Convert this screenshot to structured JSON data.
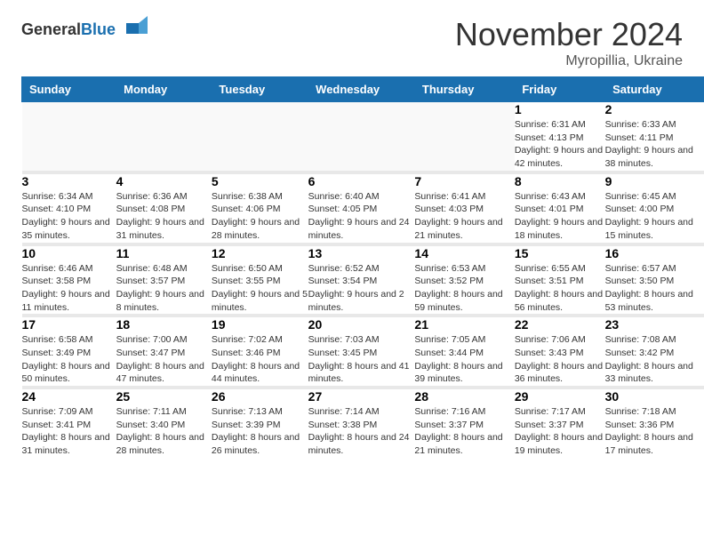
{
  "logo": {
    "general": "General",
    "blue": "Blue"
  },
  "title": "November 2024",
  "location": "Myropillia, Ukraine",
  "weekdays": [
    "Sunday",
    "Monday",
    "Tuesday",
    "Wednesday",
    "Thursday",
    "Friday",
    "Saturday"
  ],
  "weeks": [
    [
      {
        "day": "",
        "sunrise": "",
        "sunset": "",
        "daylight": ""
      },
      {
        "day": "",
        "sunrise": "",
        "sunset": "",
        "daylight": ""
      },
      {
        "day": "",
        "sunrise": "",
        "sunset": "",
        "daylight": ""
      },
      {
        "day": "",
        "sunrise": "",
        "sunset": "",
        "daylight": ""
      },
      {
        "day": "",
        "sunrise": "",
        "sunset": "",
        "daylight": ""
      },
      {
        "day": "1",
        "sunrise": "Sunrise: 6:31 AM",
        "sunset": "Sunset: 4:13 PM",
        "daylight": "Daylight: 9 hours and 42 minutes."
      },
      {
        "day": "2",
        "sunrise": "Sunrise: 6:33 AM",
        "sunset": "Sunset: 4:11 PM",
        "daylight": "Daylight: 9 hours and 38 minutes."
      }
    ],
    [
      {
        "day": "3",
        "sunrise": "Sunrise: 6:34 AM",
        "sunset": "Sunset: 4:10 PM",
        "daylight": "Daylight: 9 hours and 35 minutes."
      },
      {
        "day": "4",
        "sunrise": "Sunrise: 6:36 AM",
        "sunset": "Sunset: 4:08 PM",
        "daylight": "Daylight: 9 hours and 31 minutes."
      },
      {
        "day": "5",
        "sunrise": "Sunrise: 6:38 AM",
        "sunset": "Sunset: 4:06 PM",
        "daylight": "Daylight: 9 hours and 28 minutes."
      },
      {
        "day": "6",
        "sunrise": "Sunrise: 6:40 AM",
        "sunset": "Sunset: 4:05 PM",
        "daylight": "Daylight: 9 hours and 24 minutes."
      },
      {
        "day": "7",
        "sunrise": "Sunrise: 6:41 AM",
        "sunset": "Sunset: 4:03 PM",
        "daylight": "Daylight: 9 hours and 21 minutes."
      },
      {
        "day": "8",
        "sunrise": "Sunrise: 6:43 AM",
        "sunset": "Sunset: 4:01 PM",
        "daylight": "Daylight: 9 hours and 18 minutes."
      },
      {
        "day": "9",
        "sunrise": "Sunrise: 6:45 AM",
        "sunset": "Sunset: 4:00 PM",
        "daylight": "Daylight: 9 hours and 15 minutes."
      }
    ],
    [
      {
        "day": "10",
        "sunrise": "Sunrise: 6:46 AM",
        "sunset": "Sunset: 3:58 PM",
        "daylight": "Daylight: 9 hours and 11 minutes."
      },
      {
        "day": "11",
        "sunrise": "Sunrise: 6:48 AM",
        "sunset": "Sunset: 3:57 PM",
        "daylight": "Daylight: 9 hours and 8 minutes."
      },
      {
        "day": "12",
        "sunrise": "Sunrise: 6:50 AM",
        "sunset": "Sunset: 3:55 PM",
        "daylight": "Daylight: 9 hours and 5 minutes."
      },
      {
        "day": "13",
        "sunrise": "Sunrise: 6:52 AM",
        "sunset": "Sunset: 3:54 PM",
        "daylight": "Daylight: 9 hours and 2 minutes."
      },
      {
        "day": "14",
        "sunrise": "Sunrise: 6:53 AM",
        "sunset": "Sunset: 3:52 PM",
        "daylight": "Daylight: 8 hours and 59 minutes."
      },
      {
        "day": "15",
        "sunrise": "Sunrise: 6:55 AM",
        "sunset": "Sunset: 3:51 PM",
        "daylight": "Daylight: 8 hours and 56 minutes."
      },
      {
        "day": "16",
        "sunrise": "Sunrise: 6:57 AM",
        "sunset": "Sunset: 3:50 PM",
        "daylight": "Daylight: 8 hours and 53 minutes."
      }
    ],
    [
      {
        "day": "17",
        "sunrise": "Sunrise: 6:58 AM",
        "sunset": "Sunset: 3:49 PM",
        "daylight": "Daylight: 8 hours and 50 minutes."
      },
      {
        "day": "18",
        "sunrise": "Sunrise: 7:00 AM",
        "sunset": "Sunset: 3:47 PM",
        "daylight": "Daylight: 8 hours and 47 minutes."
      },
      {
        "day": "19",
        "sunrise": "Sunrise: 7:02 AM",
        "sunset": "Sunset: 3:46 PM",
        "daylight": "Daylight: 8 hours and 44 minutes."
      },
      {
        "day": "20",
        "sunrise": "Sunrise: 7:03 AM",
        "sunset": "Sunset: 3:45 PM",
        "daylight": "Daylight: 8 hours and 41 minutes."
      },
      {
        "day": "21",
        "sunrise": "Sunrise: 7:05 AM",
        "sunset": "Sunset: 3:44 PM",
        "daylight": "Daylight: 8 hours and 39 minutes."
      },
      {
        "day": "22",
        "sunrise": "Sunrise: 7:06 AM",
        "sunset": "Sunset: 3:43 PM",
        "daylight": "Daylight: 8 hours and 36 minutes."
      },
      {
        "day": "23",
        "sunrise": "Sunrise: 7:08 AM",
        "sunset": "Sunset: 3:42 PM",
        "daylight": "Daylight: 8 hours and 33 minutes."
      }
    ],
    [
      {
        "day": "24",
        "sunrise": "Sunrise: 7:09 AM",
        "sunset": "Sunset: 3:41 PM",
        "daylight": "Daylight: 8 hours and 31 minutes."
      },
      {
        "day": "25",
        "sunrise": "Sunrise: 7:11 AM",
        "sunset": "Sunset: 3:40 PM",
        "daylight": "Daylight: 8 hours and 28 minutes."
      },
      {
        "day": "26",
        "sunrise": "Sunrise: 7:13 AM",
        "sunset": "Sunset: 3:39 PM",
        "daylight": "Daylight: 8 hours and 26 minutes."
      },
      {
        "day": "27",
        "sunrise": "Sunrise: 7:14 AM",
        "sunset": "Sunset: 3:38 PM",
        "daylight": "Daylight: 8 hours and 24 minutes."
      },
      {
        "day": "28",
        "sunrise": "Sunrise: 7:16 AM",
        "sunset": "Sunset: 3:37 PM",
        "daylight": "Daylight: 8 hours and 21 minutes."
      },
      {
        "day": "29",
        "sunrise": "Sunrise: 7:17 AM",
        "sunset": "Sunset: 3:37 PM",
        "daylight": "Daylight: 8 hours and 19 minutes."
      },
      {
        "day": "30",
        "sunrise": "Sunrise: 7:18 AM",
        "sunset": "Sunset: 3:36 PM",
        "daylight": "Daylight: 8 hours and 17 minutes."
      }
    ]
  ]
}
